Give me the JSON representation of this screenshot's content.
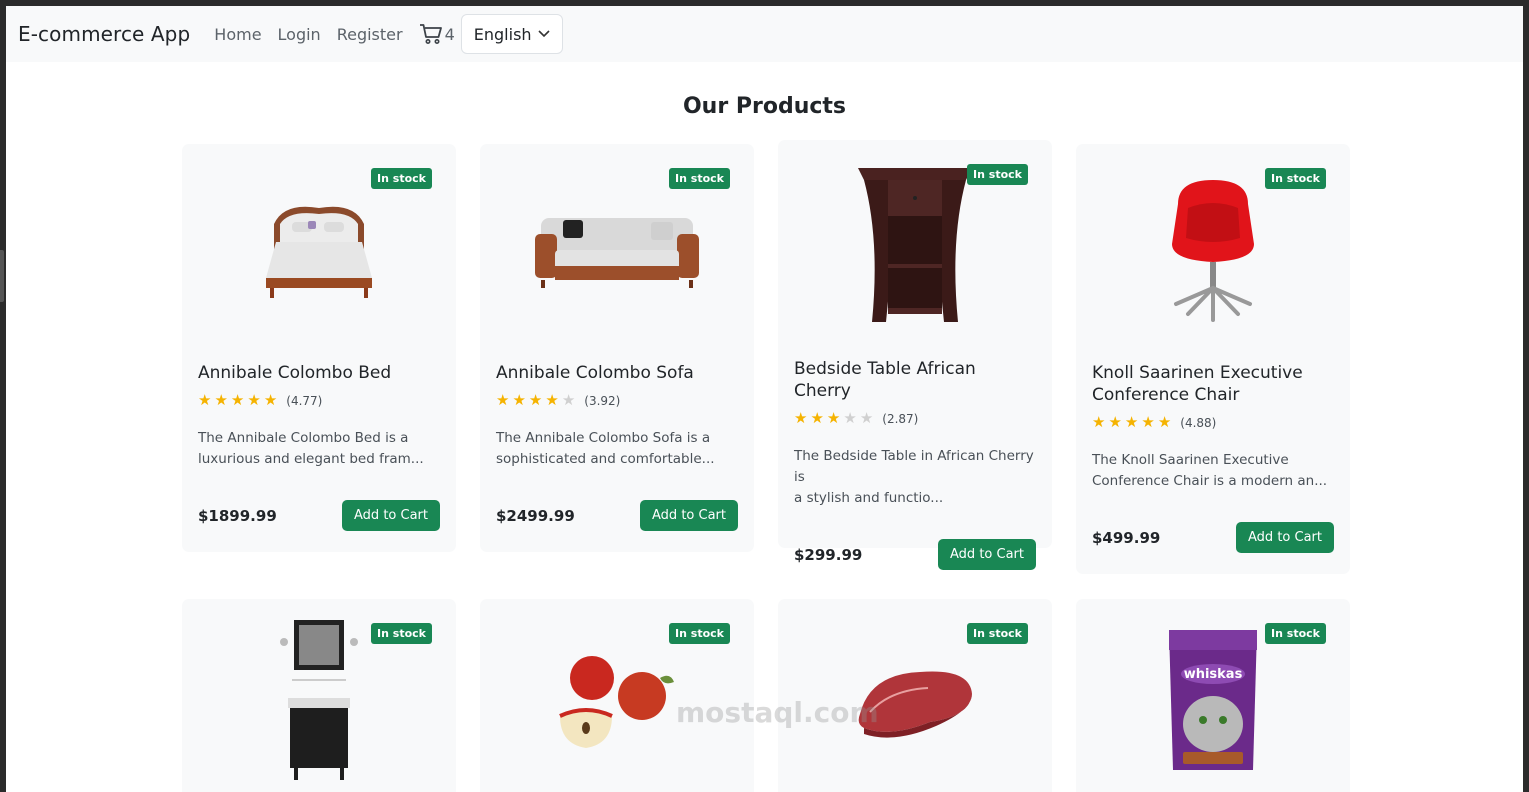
{
  "navbar": {
    "brand": "E-commerce App",
    "links": [
      "Home",
      "Login",
      "Register"
    ],
    "cart_count": "4",
    "language": "English"
  },
  "page_title": "Our Products",
  "products": [
    {
      "badge": "In stock",
      "title": "Annibale Colombo Bed",
      "stars": 5,
      "rating": "(4.77)",
      "desc1": "The Annibale Colombo Bed is a",
      "desc2": "luxurious and elegant bed fram...",
      "price": "$1899.99",
      "button": "Add to Cart",
      "image": "bed"
    },
    {
      "badge": "In stock",
      "title": "Annibale Colombo Sofa",
      "stars": 4,
      "rating": "(3.92)",
      "desc1": "The Annibale Colombo Sofa is a",
      "desc2": "sophisticated and comfortable...",
      "price": "$2499.99",
      "button": "Add to Cart",
      "image": "sofa"
    },
    {
      "badge": "In stock",
      "title": "Bedside Table African Cherry",
      "stars": 3,
      "rating": "(2.87)",
      "desc1": "The Bedside Table in African Cherry is",
      "desc2": "a stylish and functio...",
      "price": "$299.99",
      "button": "Add to Cart",
      "image": "table"
    },
    {
      "badge": "In stock",
      "title": "Knoll Saarinen Executive Conference Chair",
      "stars": 5,
      "rating": "(4.88)",
      "desc1": "The Knoll Saarinen Executive",
      "desc2": "Conference Chair is a modern an...",
      "price": "$499.99",
      "button": "Add to Cart",
      "image": "chair"
    },
    {
      "badge": "In stock",
      "image": "vanity"
    },
    {
      "badge": "In stock",
      "image": "apples"
    },
    {
      "badge": "In stock",
      "image": "steak"
    },
    {
      "badge": "In stock",
      "image": "cat-food"
    }
  ],
  "watermark": "mostaql.com",
  "colors": {
    "accent": "#198754",
    "star": "#f5b301"
  }
}
